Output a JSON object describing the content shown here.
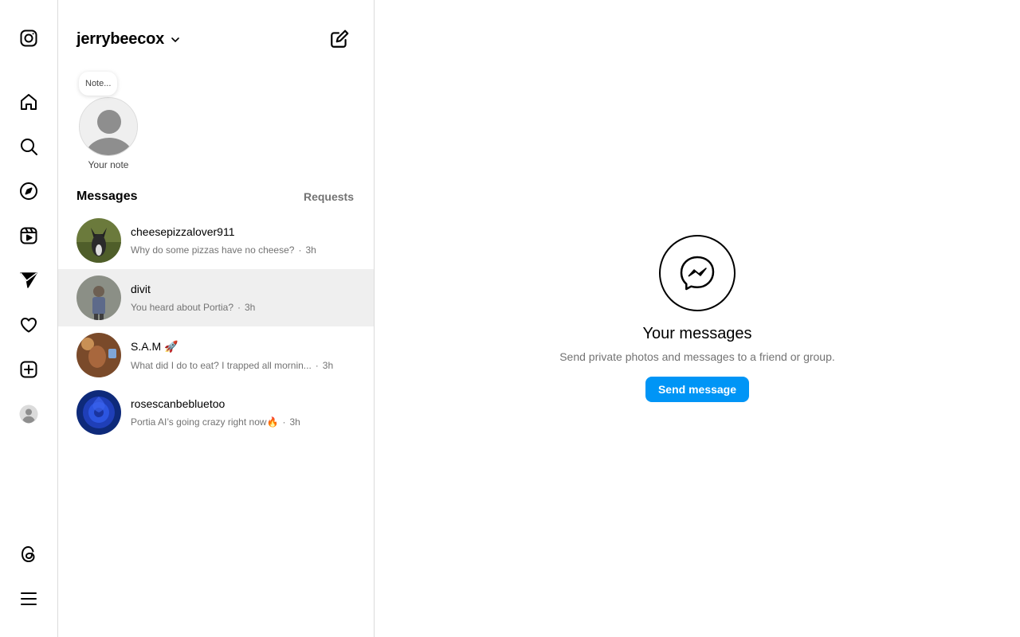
{
  "nav": {
    "items": [
      {
        "icon": "instagram-logo-icon"
      },
      {
        "icon": "home-icon"
      },
      {
        "icon": "search-icon"
      },
      {
        "icon": "explore-compass-icon"
      },
      {
        "icon": "reels-icon"
      },
      {
        "icon": "messages-icon"
      },
      {
        "icon": "notifications-heart-icon"
      },
      {
        "icon": "create-plus-icon"
      },
      {
        "icon": "profile-avatar-icon"
      },
      {
        "icon": "threads-icon"
      },
      {
        "icon": "more-menu-icon"
      }
    ]
  },
  "inbox": {
    "username": "jerrybeecox",
    "note_placeholder": "Note...",
    "note_label": "Your note",
    "messages_heading": "Messages",
    "requests_label": "Requests",
    "threads": [
      {
        "name": "cheesepizzalover911",
        "preview": "Why do some pizzas have no cheese?",
        "time": "3h",
        "avatar_color": "#6b7a3c"
      },
      {
        "name": "divit",
        "preview": "You heard about Portia?",
        "time": "3h",
        "avatar_color": "#8b8f86"
      },
      {
        "name": "S.A.M 🚀",
        "preview": "What did I do to eat? I trapped all mornin...",
        "time": "3h",
        "avatar_color": "#7a4a2a"
      },
      {
        "name": "rosescanbebluetoo",
        "preview": "Portia AI’s going crazy right now🔥",
        "time": "3h",
        "avatar_color": "#1f3fb8"
      }
    ]
  },
  "empty_state": {
    "title": "Your messages",
    "subtitle": "Send private photos and messages to a friend or group.",
    "button_label": "Send message"
  },
  "colors": {
    "accent": "#0095f6",
    "secondary_text": "#737373",
    "border": "#dbdbdb",
    "active_row": "#efefef"
  }
}
